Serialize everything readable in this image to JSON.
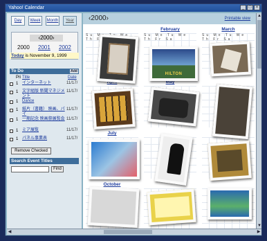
{
  "window": {
    "title": "Yahoo! Calendar"
  },
  "view_tabs": [
    "Day",
    "Week",
    "Month",
    "Year"
  ],
  "year_nav": {
    "current": "2000",
    "current_display": "‹2000›",
    "years": [
      "2000",
      "2001",
      "2002"
    ]
  },
  "today": {
    "label": "Today",
    "text": "is November 9, 1999"
  },
  "todo": {
    "heading": "To Do",
    "add_label": "Add",
    "columns": {
      "pri": "Pri",
      "title": "Title",
      "date": "Date"
    },
    "items": [
      {
        "pri": "1",
        "title": "インターネット",
        "due": "11/17/"
      },
      {
        "pri": "1",
        "title": "文字組版 新聞マネジメント",
        "due": "11/17/"
      },
      {
        "pri": "1",
        "title": "Dance",
        "due": ""
      },
      {
        "pri": "1",
        "title": "紙片（書籍） 映画、パイ",
        "due": "11/17/"
      },
      {
        "pri": "1",
        "title": "一期記念 映画祭展覧会",
        "due": "11/17/"
      },
      {
        "pri": "1",
        "title": "ミア展覧",
        "due": "11/17/"
      },
      {
        "pri": "1",
        "title": "パネル事業表",
        "due": "11/17/"
      }
    ],
    "remove_label": "Remove Checked"
  },
  "search": {
    "heading": "Search Event Titles",
    "find_label": "Find",
    "value": ""
  },
  "year_view": {
    "title": "‹2000›",
    "right_link": "Printable view",
    "days_header": "Su Mo Tu We Th Fr Sa",
    "month_labels": {
      "feb": "February",
      "mar": "March",
      "apr": "April",
      "may": "May",
      "jul": "July",
      "oct": "October"
    },
    "photo_labels": {
      "hilton": "HILTON"
    }
  },
  "colors": {
    "window_bg": "#8ab2c4",
    "link": "#1b3a9c",
    "section_header": "#3e6d9a"
  }
}
